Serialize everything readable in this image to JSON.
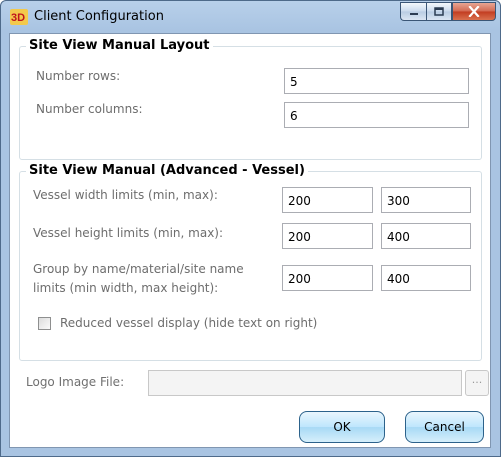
{
  "window": {
    "title": "Client Configuration",
    "app_icon": "3d-app-icon",
    "controls": {
      "minimize": "minimize-icon",
      "maximize": "maximize-icon",
      "close": "close-icon"
    }
  },
  "layout_group": {
    "title": "Site View Manual Layout",
    "rows_label": "Number rows:",
    "rows_value": "5",
    "cols_label": "Number columns:",
    "cols_value": "6"
  },
  "vessel_group": {
    "title": "Site View Manual (Advanced - Vessel)",
    "width_label": "Vessel width limits (min, max):",
    "width_min": "200",
    "width_max": "300",
    "height_label": "Vessel height limits (min, max):",
    "height_min": "200",
    "height_max": "400",
    "group_label_line1": "Group by name/material/site name",
    "group_label_line2": "limits (min width, max height):",
    "group_min": "200",
    "group_max": "400",
    "reduced_label": "Reduced vessel display (hide text on right)",
    "reduced_checked": false
  },
  "logo": {
    "label": "Logo Image File:",
    "value": "",
    "browse_label": "..."
  },
  "buttons": {
    "ok": "OK",
    "cancel": "Cancel"
  },
  "colors": {
    "title_bar": "#a9c4e2",
    "close_button": "#c23c20",
    "button_face": "#bee6fd",
    "label_text": "#6d6d6d"
  }
}
